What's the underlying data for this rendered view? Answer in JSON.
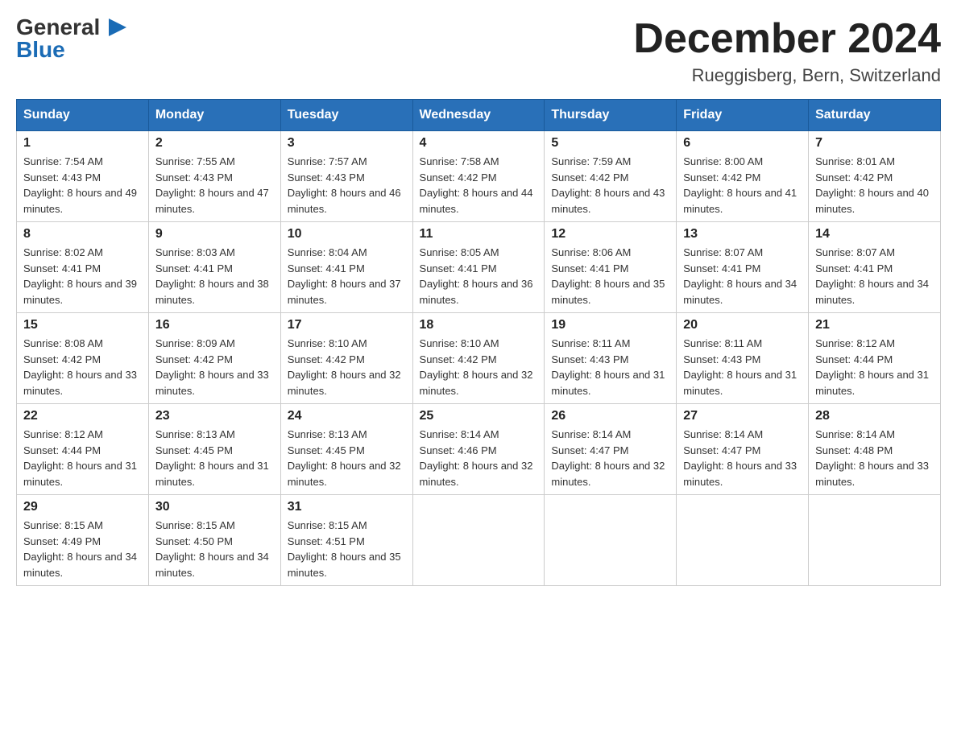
{
  "header": {
    "logo_general": "General",
    "logo_triangle": "▶",
    "logo_blue": "Blue",
    "month_title": "December 2024",
    "location": "Rueggisberg, Bern, Switzerland"
  },
  "days_of_week": [
    "Sunday",
    "Monday",
    "Tuesday",
    "Wednesday",
    "Thursday",
    "Friday",
    "Saturday"
  ],
  "weeks": [
    [
      {
        "day": "1",
        "sunrise": "7:54 AM",
        "sunset": "4:43 PM",
        "daylight": "8 hours and 49 minutes."
      },
      {
        "day": "2",
        "sunrise": "7:55 AM",
        "sunset": "4:43 PM",
        "daylight": "8 hours and 47 minutes."
      },
      {
        "day": "3",
        "sunrise": "7:57 AM",
        "sunset": "4:43 PM",
        "daylight": "8 hours and 46 minutes."
      },
      {
        "day": "4",
        "sunrise": "7:58 AM",
        "sunset": "4:42 PM",
        "daylight": "8 hours and 44 minutes."
      },
      {
        "day": "5",
        "sunrise": "7:59 AM",
        "sunset": "4:42 PM",
        "daylight": "8 hours and 43 minutes."
      },
      {
        "day": "6",
        "sunrise": "8:00 AM",
        "sunset": "4:42 PM",
        "daylight": "8 hours and 41 minutes."
      },
      {
        "day": "7",
        "sunrise": "8:01 AM",
        "sunset": "4:42 PM",
        "daylight": "8 hours and 40 minutes."
      }
    ],
    [
      {
        "day": "8",
        "sunrise": "8:02 AM",
        "sunset": "4:41 PM",
        "daylight": "8 hours and 39 minutes."
      },
      {
        "day": "9",
        "sunrise": "8:03 AM",
        "sunset": "4:41 PM",
        "daylight": "8 hours and 38 minutes."
      },
      {
        "day": "10",
        "sunrise": "8:04 AM",
        "sunset": "4:41 PM",
        "daylight": "8 hours and 37 minutes."
      },
      {
        "day": "11",
        "sunrise": "8:05 AM",
        "sunset": "4:41 PM",
        "daylight": "8 hours and 36 minutes."
      },
      {
        "day": "12",
        "sunrise": "8:06 AM",
        "sunset": "4:41 PM",
        "daylight": "8 hours and 35 minutes."
      },
      {
        "day": "13",
        "sunrise": "8:07 AM",
        "sunset": "4:41 PM",
        "daylight": "8 hours and 34 minutes."
      },
      {
        "day": "14",
        "sunrise": "8:07 AM",
        "sunset": "4:41 PM",
        "daylight": "8 hours and 34 minutes."
      }
    ],
    [
      {
        "day": "15",
        "sunrise": "8:08 AM",
        "sunset": "4:42 PM",
        "daylight": "8 hours and 33 minutes."
      },
      {
        "day": "16",
        "sunrise": "8:09 AM",
        "sunset": "4:42 PM",
        "daylight": "8 hours and 33 minutes."
      },
      {
        "day": "17",
        "sunrise": "8:10 AM",
        "sunset": "4:42 PM",
        "daylight": "8 hours and 32 minutes."
      },
      {
        "day": "18",
        "sunrise": "8:10 AM",
        "sunset": "4:42 PM",
        "daylight": "8 hours and 32 minutes."
      },
      {
        "day": "19",
        "sunrise": "8:11 AM",
        "sunset": "4:43 PM",
        "daylight": "8 hours and 31 minutes."
      },
      {
        "day": "20",
        "sunrise": "8:11 AM",
        "sunset": "4:43 PM",
        "daylight": "8 hours and 31 minutes."
      },
      {
        "day": "21",
        "sunrise": "8:12 AM",
        "sunset": "4:44 PM",
        "daylight": "8 hours and 31 minutes."
      }
    ],
    [
      {
        "day": "22",
        "sunrise": "8:12 AM",
        "sunset": "4:44 PM",
        "daylight": "8 hours and 31 minutes."
      },
      {
        "day": "23",
        "sunrise": "8:13 AM",
        "sunset": "4:45 PM",
        "daylight": "8 hours and 31 minutes."
      },
      {
        "day": "24",
        "sunrise": "8:13 AM",
        "sunset": "4:45 PM",
        "daylight": "8 hours and 32 minutes."
      },
      {
        "day": "25",
        "sunrise": "8:14 AM",
        "sunset": "4:46 PM",
        "daylight": "8 hours and 32 minutes."
      },
      {
        "day": "26",
        "sunrise": "8:14 AM",
        "sunset": "4:47 PM",
        "daylight": "8 hours and 32 minutes."
      },
      {
        "day": "27",
        "sunrise": "8:14 AM",
        "sunset": "4:47 PM",
        "daylight": "8 hours and 33 minutes."
      },
      {
        "day": "28",
        "sunrise": "8:14 AM",
        "sunset": "4:48 PM",
        "daylight": "8 hours and 33 minutes."
      }
    ],
    [
      {
        "day": "29",
        "sunrise": "8:15 AM",
        "sunset": "4:49 PM",
        "daylight": "8 hours and 34 minutes."
      },
      {
        "day": "30",
        "sunrise": "8:15 AM",
        "sunset": "4:50 PM",
        "daylight": "8 hours and 34 minutes."
      },
      {
        "day": "31",
        "sunrise": "8:15 AM",
        "sunset": "4:51 PM",
        "daylight": "8 hours and 35 minutes."
      },
      null,
      null,
      null,
      null
    ]
  ],
  "labels": {
    "sunrise_prefix": "Sunrise: ",
    "sunset_prefix": "Sunset: ",
    "daylight_prefix": "Daylight: "
  }
}
